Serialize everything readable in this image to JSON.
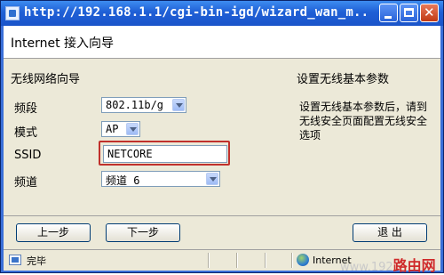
{
  "window": {
    "title": "http://192.168.1.1/cgi-bin-igd/wizard_wan_m..."
  },
  "header": {
    "title": "Internet 接入向导"
  },
  "wizard": {
    "section_title": "无线网络向导",
    "fields": {
      "band": {
        "label": "频段",
        "value": "802.11b/g"
      },
      "mode": {
        "label": "模式",
        "value": "AP"
      },
      "ssid": {
        "label": "SSID",
        "value": "NETCORE"
      },
      "channel": {
        "label": "频道",
        "value": "频道 6"
      }
    }
  },
  "help": {
    "title": "设置无线基本参数",
    "description": "设置无线基本参数后，请到无线安全页面配置无线安全选项"
  },
  "buttons": {
    "prev": "上一步",
    "next": "下一步",
    "exit": "退 出"
  },
  "status": {
    "left": "完毕",
    "zone": "Internet"
  },
  "watermark": {
    "prefix": "www.192",
    "text": "路由网"
  },
  "colors": {
    "highlight": "#c0302b",
    "titlebar": "#1f5fd6"
  }
}
